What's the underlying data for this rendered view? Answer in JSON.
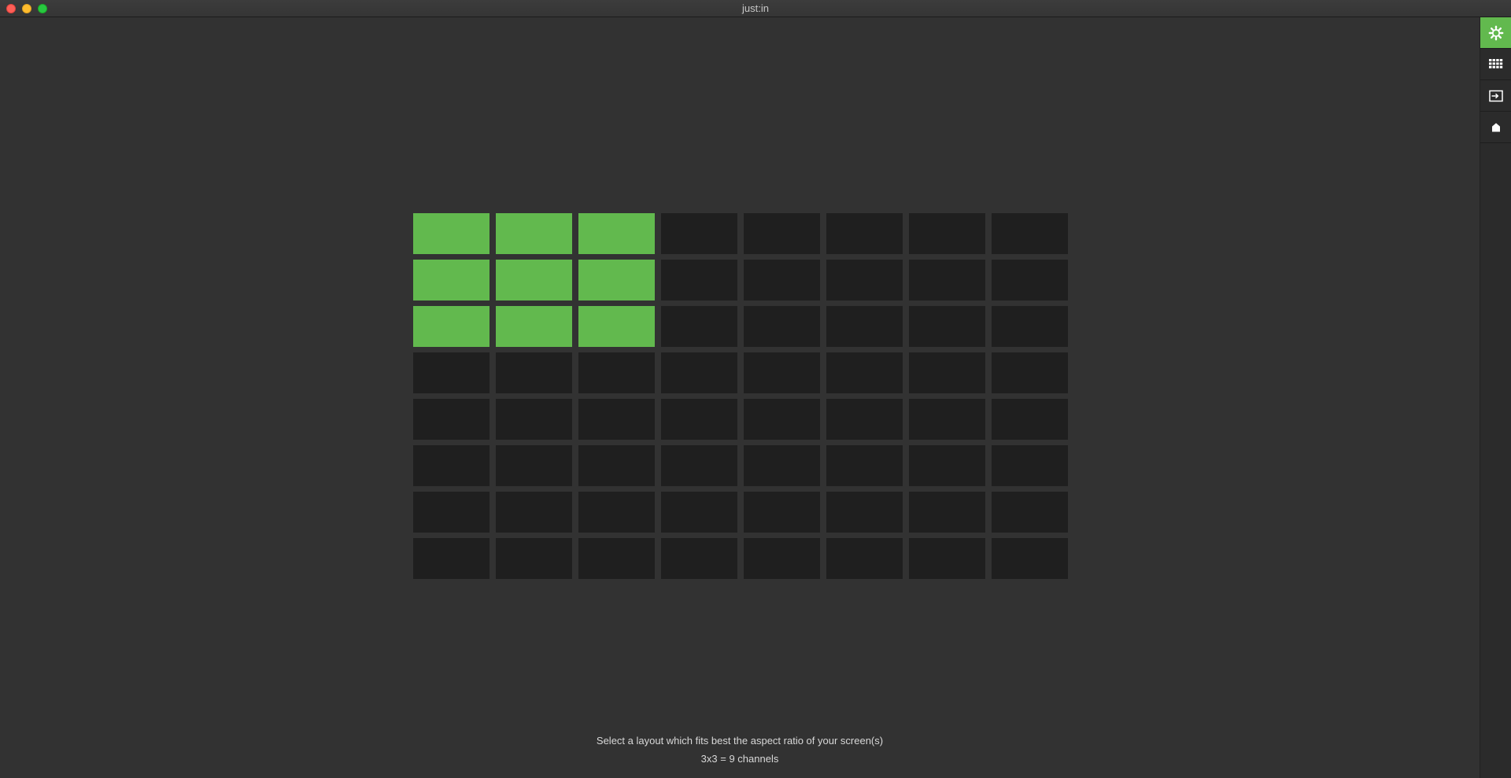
{
  "window": {
    "title": "just:in"
  },
  "layout_grid": {
    "columns": 8,
    "rows": 8,
    "selected_columns": 3,
    "selected_rows": 3,
    "selected_color": "#62b94e",
    "empty_color": "#1f1f1f"
  },
  "hint": {
    "line1": "Select a layout which fits best the aspect ratio of your screen(s)",
    "line2": "3x3 = 9 channels"
  },
  "sidebar": {
    "items": [
      {
        "icon": "gear-icon",
        "active": true
      },
      {
        "icon": "grid-icon",
        "active": false
      },
      {
        "icon": "input-icon",
        "active": false
      },
      {
        "icon": "home-icon",
        "active": false
      }
    ]
  },
  "colors": {
    "accent": "#62b94e",
    "background": "#323232",
    "sidebar": "#2b2b2b"
  }
}
